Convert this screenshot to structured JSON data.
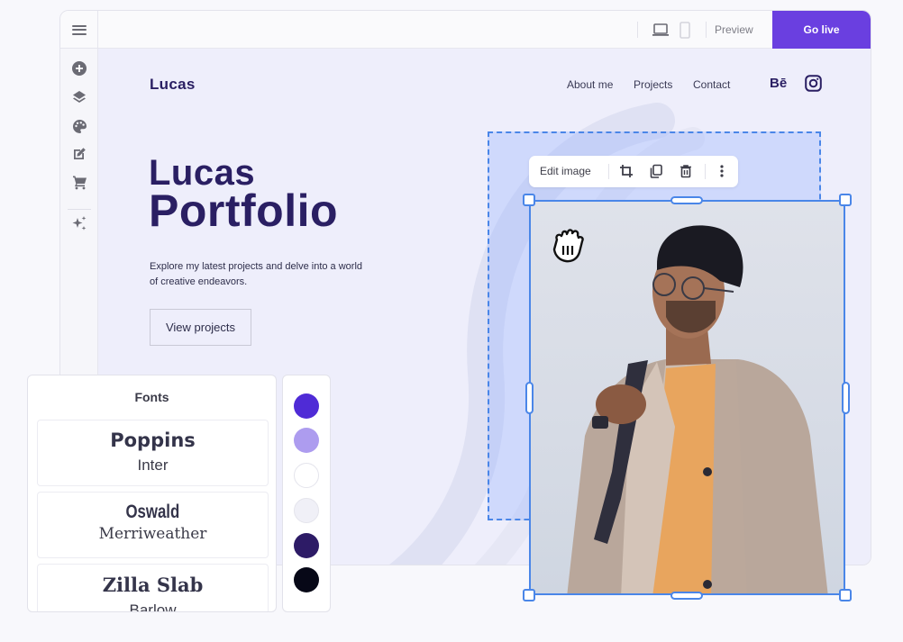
{
  "editor": {
    "topbar": {
      "menu_icon": "hamburger-menu-icon",
      "device_icons": [
        "laptop-icon",
        "mobile-icon"
      ],
      "preview_label": "Preview",
      "golive_label": "Go live",
      "accent_color": "#6a3fe0"
    },
    "sidebar": {
      "items": [
        {
          "name": "add",
          "icon": "plus-circle-icon"
        },
        {
          "name": "layers",
          "icon": "layers-icon"
        },
        {
          "name": "theme",
          "icon": "palette-icon"
        },
        {
          "name": "edit",
          "icon": "edit-icon"
        },
        {
          "name": "store",
          "icon": "cart-icon"
        },
        {
          "name": "ai",
          "icon": "sparkles-icon"
        }
      ]
    }
  },
  "site": {
    "logo": "Lucas",
    "nav": [
      "About me",
      "Projects",
      "Contact"
    ],
    "social": {
      "behance": "Bē",
      "instagram": "instagram-icon"
    },
    "hero": {
      "title_line1": "Lucas",
      "title_line2": "Portfolio",
      "description": "Explore my latest projects and delve into a world of creative endeavors.",
      "button": "View projects"
    },
    "text_color": "#2a1f63"
  },
  "image_toolbar": {
    "label": "Edit image",
    "actions": [
      "crop-icon",
      "duplicate-icon",
      "delete-icon",
      "more-icon"
    ]
  },
  "fonts_panel": {
    "title": "Fonts",
    "pairs": [
      {
        "heading": "Poppins",
        "body": "Inter"
      },
      {
        "heading": "Oswald",
        "body": "Merriweather"
      },
      {
        "heading": "Zilla Slab",
        "body": "Barlow"
      }
    ]
  },
  "color_palette": [
    "#4f2bd6",
    "#ad9cef",
    "#ffffff",
    "#f0f0f7",
    "#2d1b66",
    "#070817"
  ],
  "selection_color": "#4a86e8"
}
